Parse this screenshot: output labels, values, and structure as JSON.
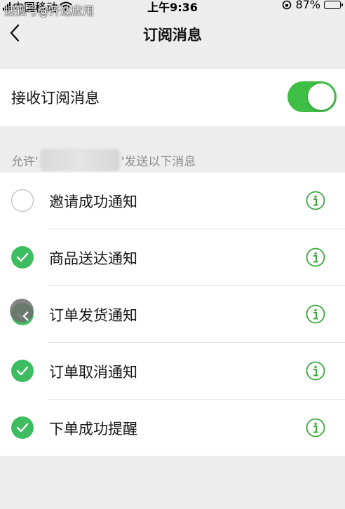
{
  "status_bar": {
    "carrier": "中国移动",
    "time": "上午9:36",
    "battery": "87%",
    "battery_level": 0.87
  },
  "watermark": "搜狐号@开达应用",
  "nav": {
    "title": "订阅消息",
    "back_icon": "chevron-left-icon"
  },
  "toggle": {
    "label": "接收订阅消息",
    "on": true,
    "accent": "#3fbe45"
  },
  "caption": {
    "prefix": "允许'",
    "suffix": "'发送以下消息"
  },
  "items": [
    {
      "label": "邀请成功通知",
      "checked": false
    },
    {
      "label": "商品送达通知",
      "checked": true
    },
    {
      "label": "订单发货通知",
      "checked": true
    },
    {
      "label": "订单取消通知",
      "checked": true
    },
    {
      "label": "下单成功提醒",
      "checked": true
    }
  ],
  "colors": {
    "check_green": "#3dbd60",
    "info_green": "#3aa83c"
  }
}
